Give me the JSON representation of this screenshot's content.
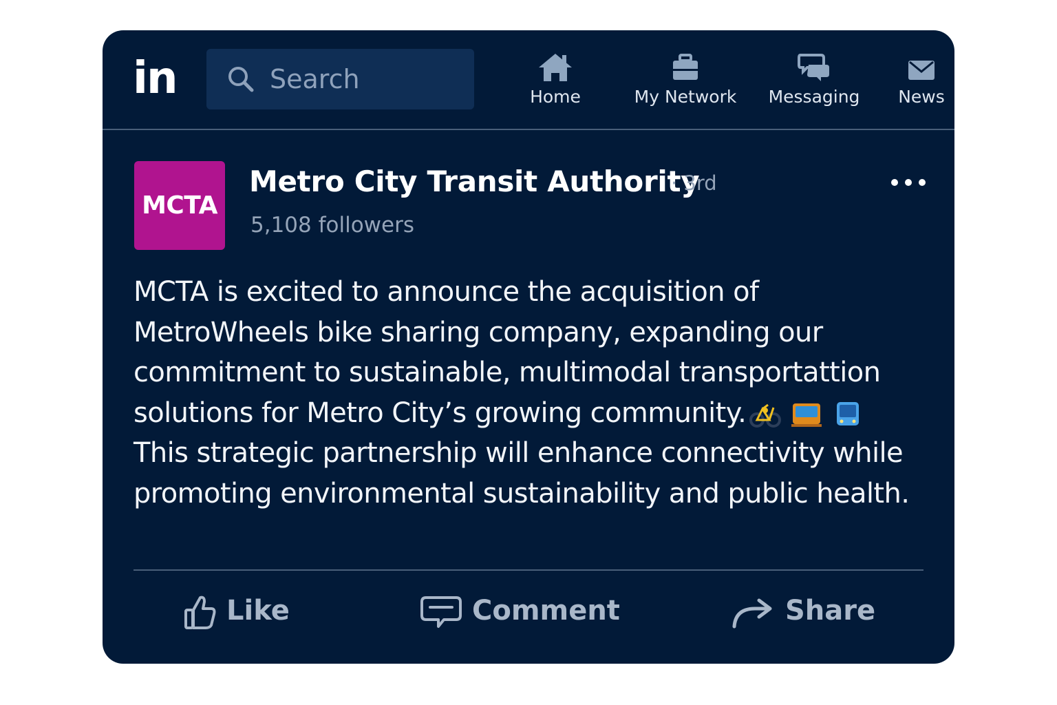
{
  "nav": {
    "logo_text": "in",
    "search_placeholder": "Search",
    "items": [
      {
        "label": "Home",
        "icon": "home-icon"
      },
      {
        "label": "My Network",
        "icon": "briefcase-icon"
      },
      {
        "label": "Messaging",
        "icon": "chat-icon"
      },
      {
        "label": "News",
        "icon": "envelope-icon"
      }
    ]
  },
  "post": {
    "avatar_text": "MCTA",
    "avatar_color": "#b0148f",
    "author": "Metro City Transit Authority",
    "degree": "· 3rd",
    "followers": "5,108 followers",
    "body_line_1": "MCTA is excited to announce the acquisition of",
    "body_line_2": "MetroWheels bike sharing company, expanding our",
    "body_line_3": "commitment to sustainable, multimodal transportattion",
    "body_line_4": "solutions for Metro City’s growing community.",
    "body_line_5": "This strategic partnership will enhance connectivity while",
    "body_line_6": "promoting environmental sustainability and public health.",
    "emojis": [
      "bicycle-emoji",
      "tram-emoji",
      "bus-emoji"
    ]
  },
  "actions": {
    "like": "Like",
    "comment": "Comment",
    "share": "Share"
  },
  "colors": {
    "background": "#021a38",
    "search_bg": "#0f2e55",
    "muted_text": "#95a4b8"
  }
}
